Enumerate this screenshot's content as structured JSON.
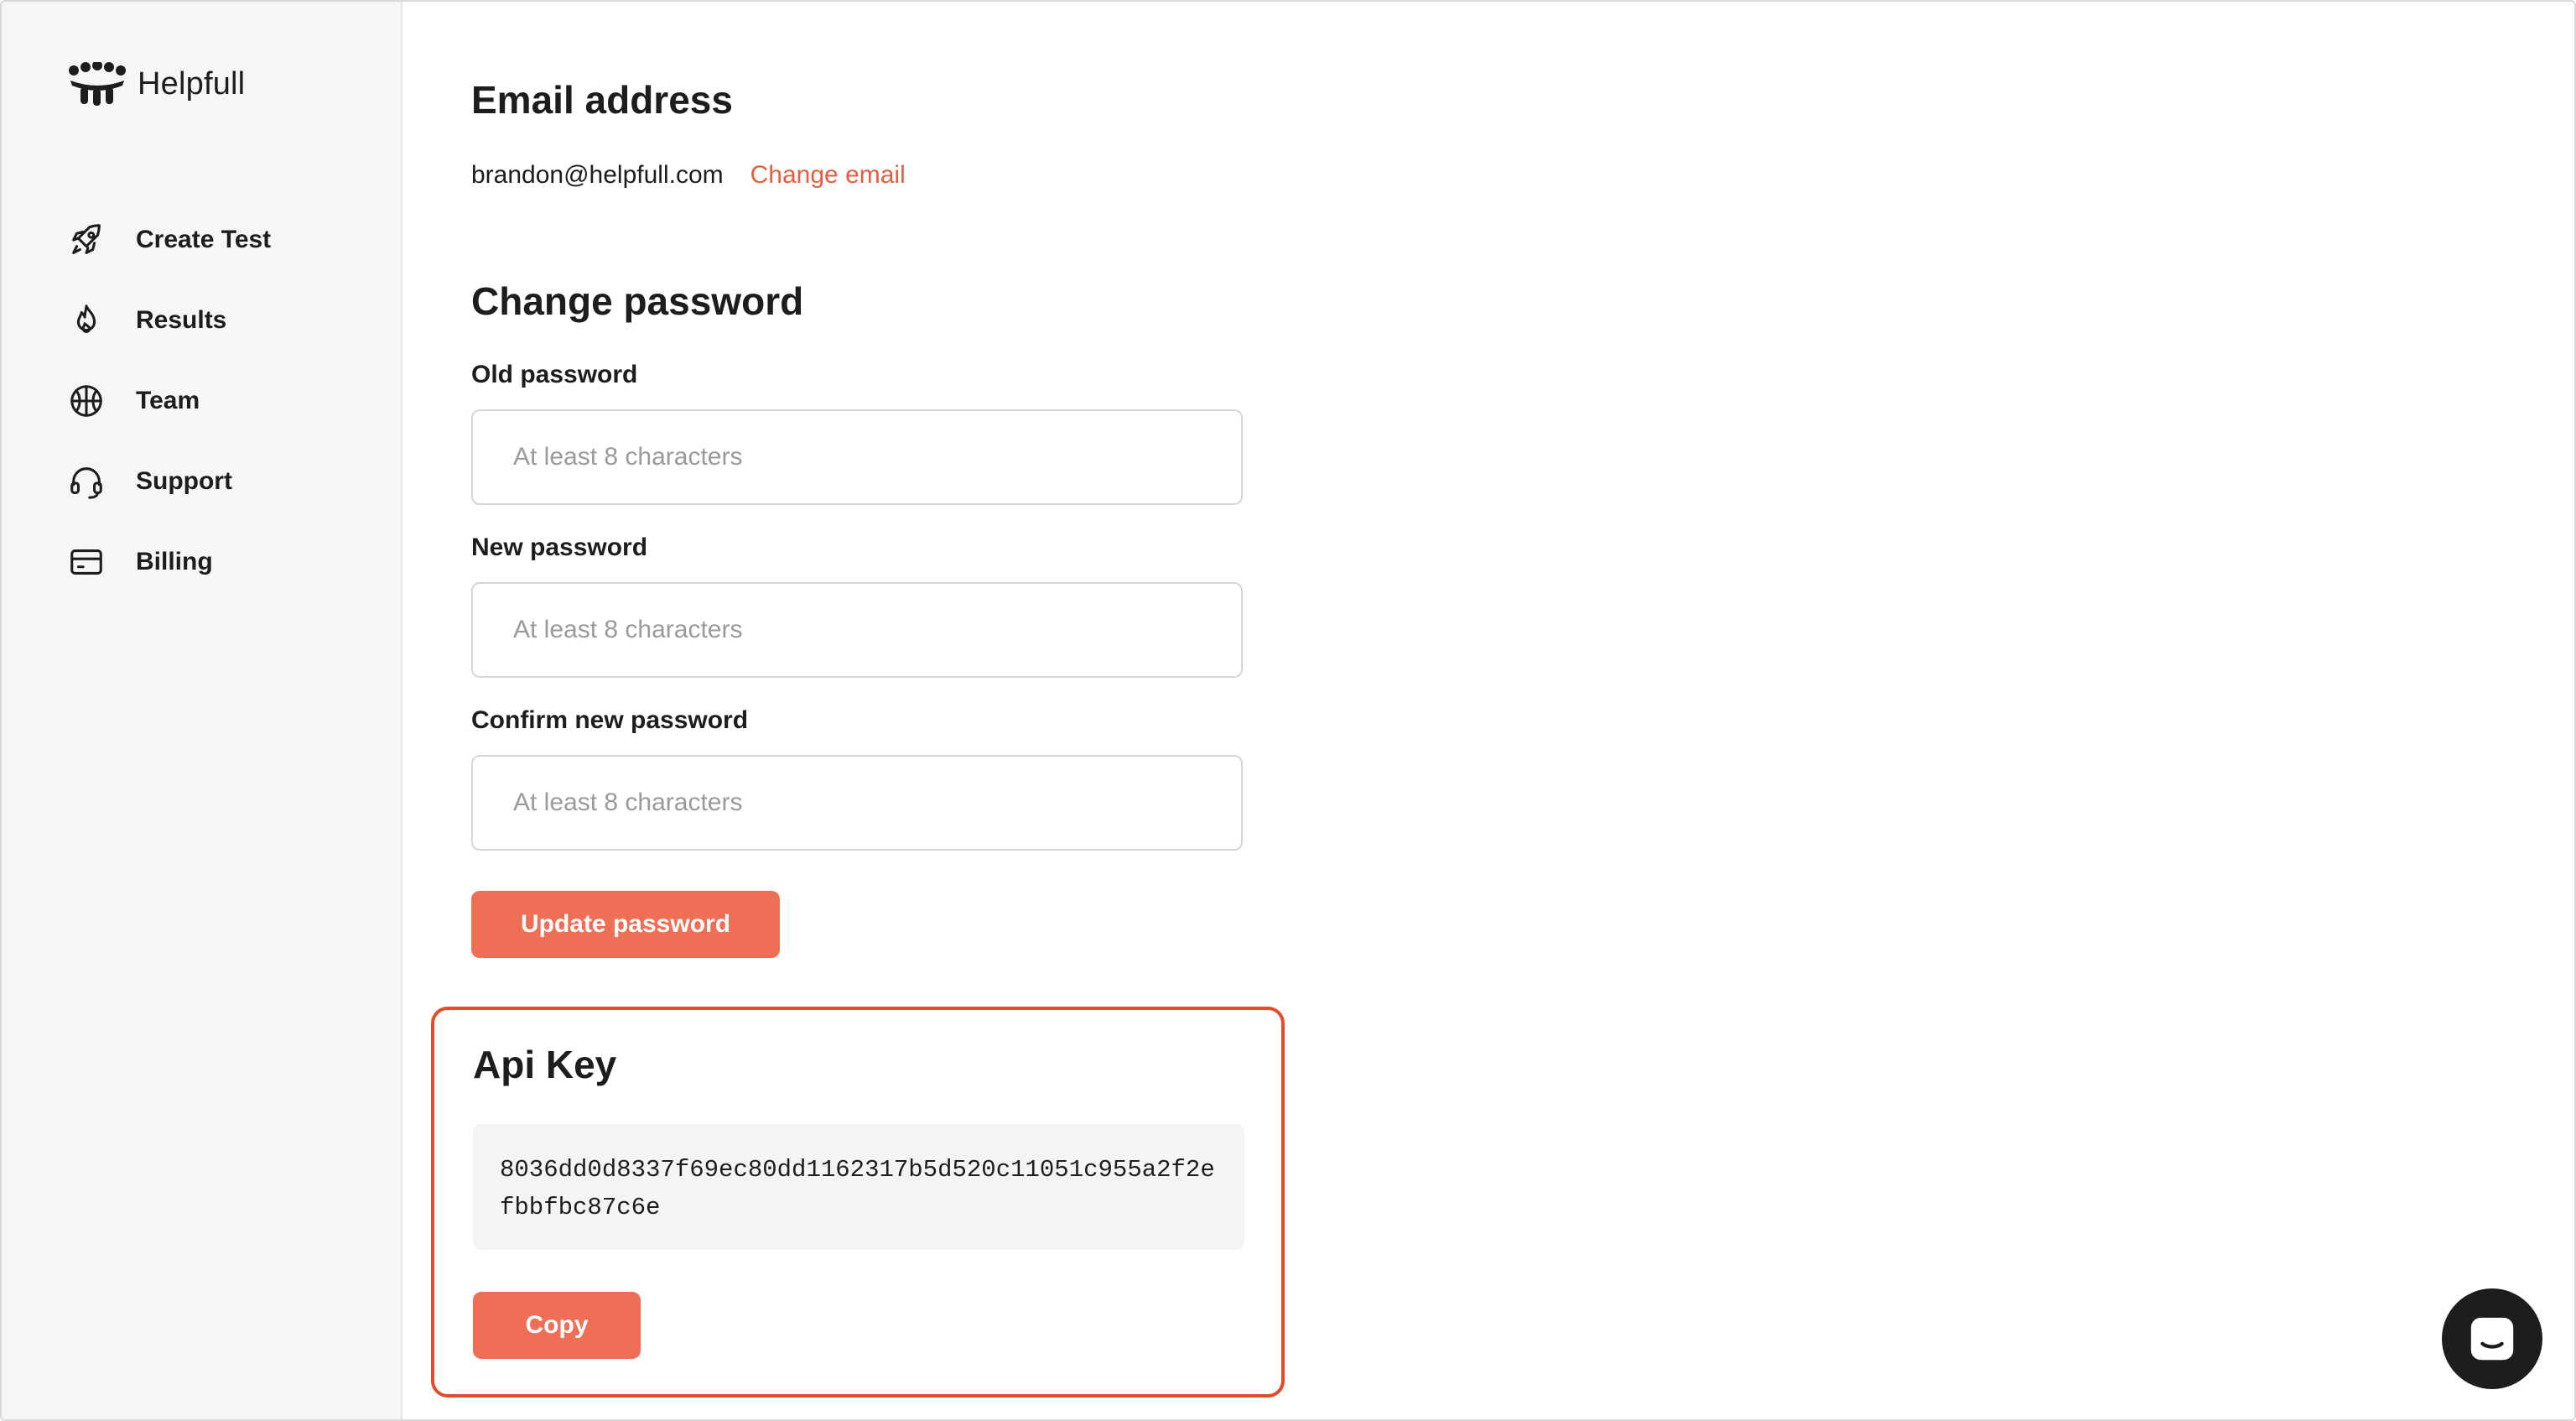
{
  "brand": {
    "name": "Helpfull"
  },
  "sidebar": {
    "items": [
      {
        "label": "Create Test",
        "icon": "rocket-icon"
      },
      {
        "label": "Results",
        "icon": "flame-icon"
      },
      {
        "label": "Team",
        "icon": "basketball-icon"
      },
      {
        "label": "Support",
        "icon": "headset-icon"
      },
      {
        "label": "Billing",
        "icon": "credit-card-icon"
      }
    ]
  },
  "email": {
    "heading": "Email address",
    "value": "brandon@helpfull.com",
    "change_label": "Change email"
  },
  "password": {
    "heading": "Change password",
    "old_label": "Old password",
    "new_label": "New password",
    "confirm_label": "Confirm new password",
    "placeholder": "At least 8 characters",
    "submit_label": "Update password"
  },
  "api": {
    "heading": "Api Key",
    "key": "8036dd0d8337f69ec80dd1162317b5d520c11051c955a2f2efbbfbc87c6e",
    "copy_label": "Copy"
  },
  "colors": {
    "accent": "#ee6e56",
    "link": "#e85c3f",
    "highlight_border": "#e54a2d",
    "sidebar_bg": "#f7f6f4"
  }
}
